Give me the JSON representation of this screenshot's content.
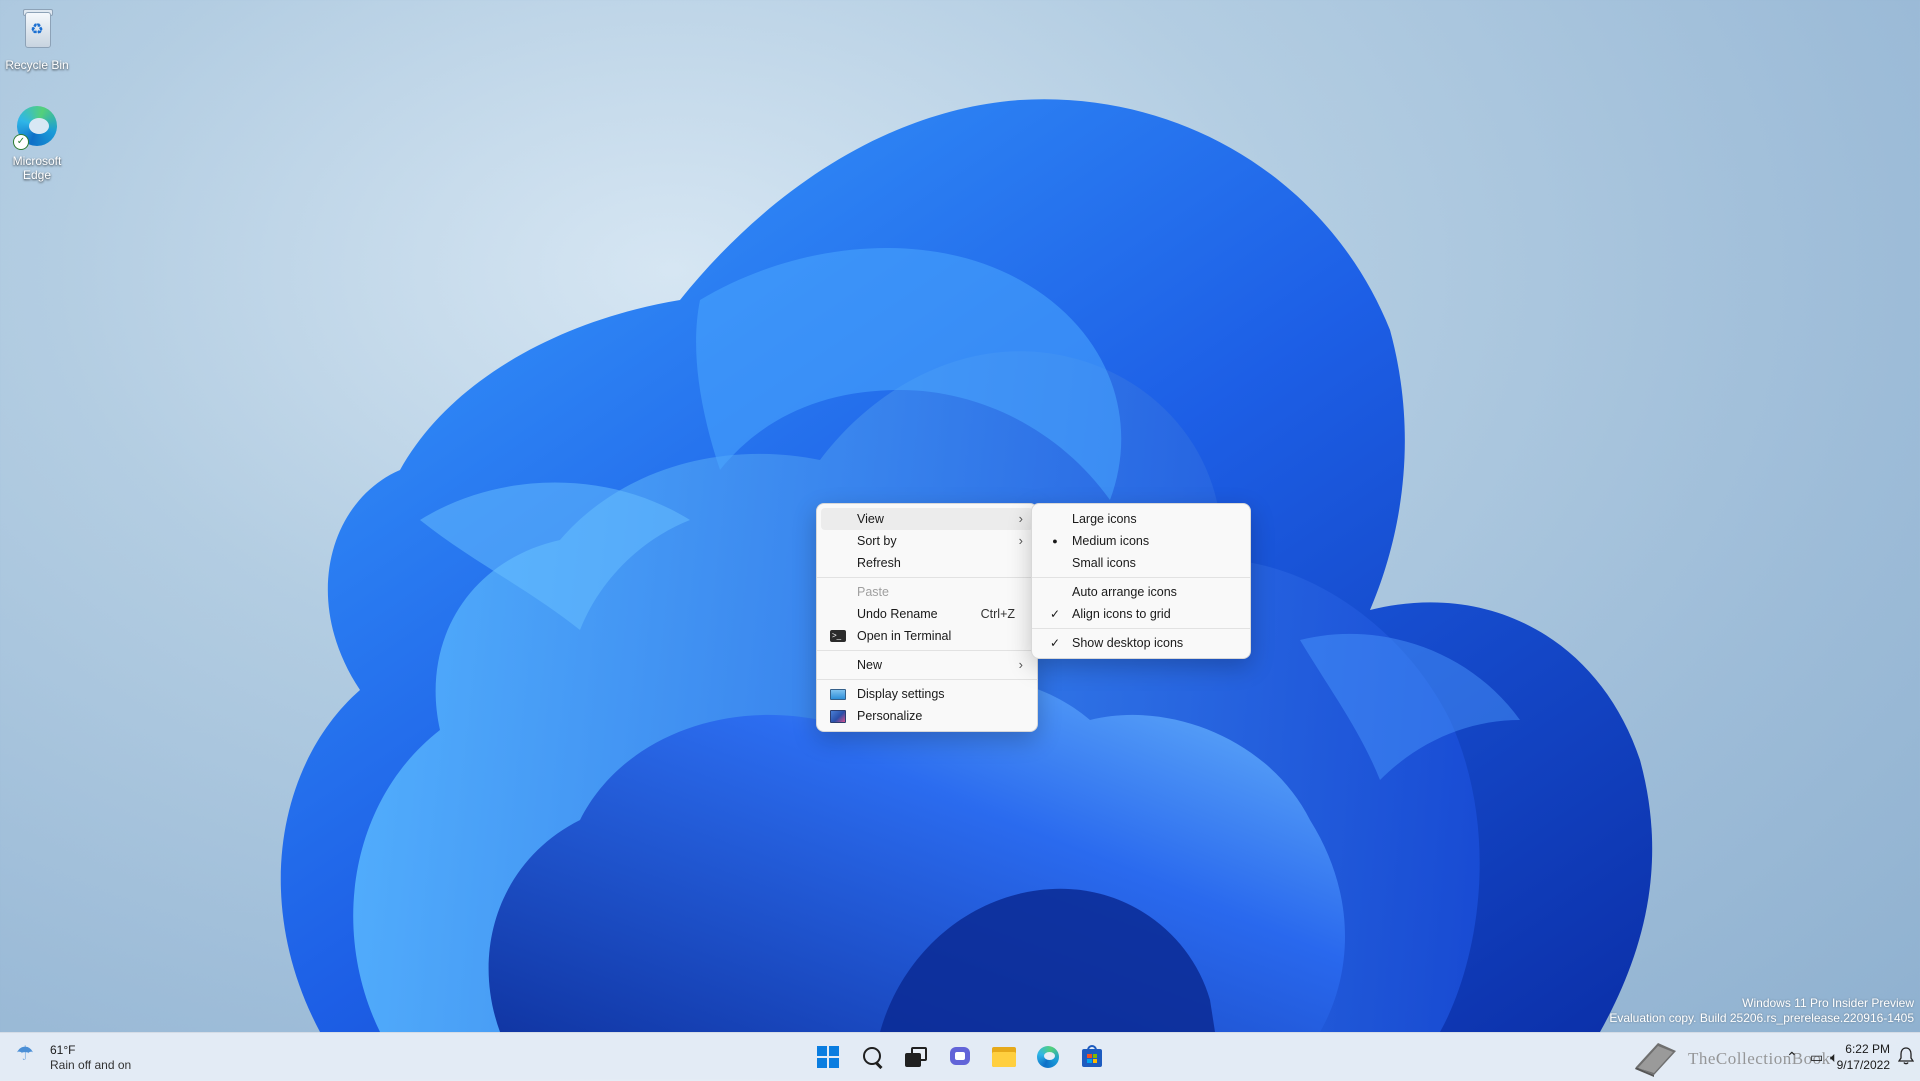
{
  "desktop": {
    "icons": [
      {
        "label": "Recycle Bin",
        "icon": "recycle-bin-icon"
      },
      {
        "label": "Microsoft Edge",
        "icon": "edge-icon"
      }
    ]
  },
  "context_menu": {
    "items": [
      {
        "label": "View",
        "submenu": true,
        "highlighted": true
      },
      {
        "label": "Sort by",
        "submenu": true
      },
      {
        "label": "Refresh"
      },
      {
        "label": "Paste",
        "disabled": true
      },
      {
        "label": "Undo Rename",
        "shortcut": "Ctrl+Z"
      },
      {
        "label": "Open in Terminal",
        "icon": "terminal-icon"
      },
      {
        "label": "New",
        "submenu": true
      },
      {
        "label": "Display settings",
        "icon": "display-settings-icon"
      },
      {
        "label": "Personalize",
        "icon": "personalize-icon"
      }
    ],
    "arrow_glyph": "›"
  },
  "view_submenu": {
    "items": [
      {
        "label": "Large icons"
      },
      {
        "label": "Medium icons",
        "state": "selected-radio"
      },
      {
        "label": "Small icons"
      },
      {
        "label": "Auto arrange icons"
      },
      {
        "label": "Align icons to grid",
        "state": "checked"
      },
      {
        "label": "Show desktop icons",
        "state": "checked"
      }
    ],
    "radio_glyph": "●",
    "check_glyph": "✓"
  },
  "watermark": {
    "line1": "Windows 11 Pro Insider Preview",
    "line2": "Evaluation copy. Build 25206.rs_prerelease.220916-1405"
  },
  "taskbar": {
    "weather": {
      "temp": "61°F",
      "condition": "Rain off and on",
      "icon": "rain-icon"
    },
    "apps": [
      "start-button",
      "search-button",
      "task-view-button",
      "chat-button",
      "file-explorer-button",
      "edge-button",
      "store-button"
    ],
    "tray_overlay_text": "TheCollectionBook",
    "clock": {
      "time": "6:22 PM",
      "date": "9/17/2022"
    }
  },
  "colors": {
    "accent": "#0a7de0",
    "menu_bg": "#f9f9f9",
    "taskbar_bg": "#e8eef6"
  }
}
